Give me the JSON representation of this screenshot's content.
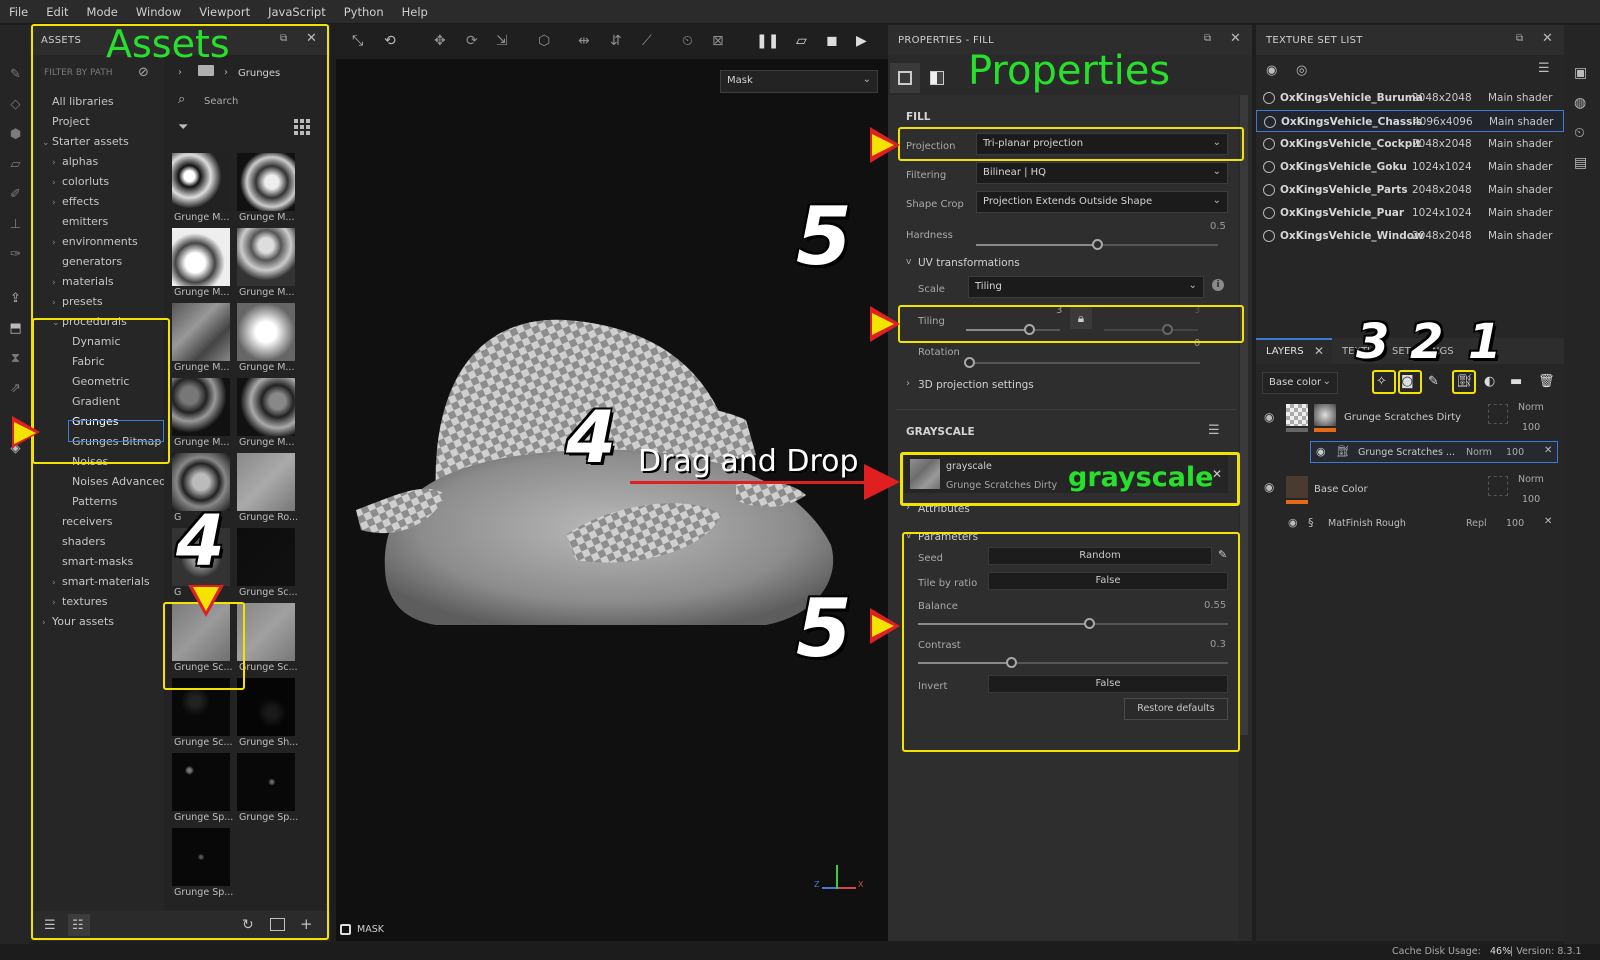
{
  "menu": [
    "File",
    "Edit",
    "Mode",
    "Window",
    "Viewport",
    "JavaScript",
    "Python",
    "Help"
  ],
  "assets": {
    "title": "ASSETS",
    "annotation": "Assets",
    "filter_label": "FILTER BY PATH",
    "breadcrumb": "Grunges",
    "search_placeholder": "Search",
    "tree": [
      {
        "label": "All libraries",
        "indent": 0,
        "chev": ""
      },
      {
        "label": "Project",
        "indent": 0,
        "chev": ""
      },
      {
        "label": "Starter assets",
        "indent": 0,
        "chev": "v"
      },
      {
        "label": "alphas",
        "indent": 1,
        "chev": ">"
      },
      {
        "label": "colorluts",
        "indent": 1,
        "chev": ">"
      },
      {
        "label": "effects",
        "indent": 1,
        "chev": ">"
      },
      {
        "label": "emitters",
        "indent": 1,
        "chev": ""
      },
      {
        "label": "environments",
        "indent": 1,
        "chev": ">"
      },
      {
        "label": "generators",
        "indent": 1,
        "chev": ""
      },
      {
        "label": "materials",
        "indent": 1,
        "chev": ">"
      },
      {
        "label": "presets",
        "indent": 1,
        "chev": ">"
      },
      {
        "label": "procedurals",
        "indent": 1,
        "chev": "v"
      },
      {
        "label": "Dynamic",
        "indent": 2,
        "chev": ""
      },
      {
        "label": "Fabric",
        "indent": 2,
        "chev": ""
      },
      {
        "label": "Geometric",
        "indent": 2,
        "chev": ""
      },
      {
        "label": "Gradient",
        "indent": 2,
        "chev": ""
      },
      {
        "label": "Grunges",
        "indent": 2,
        "chev": ""
      },
      {
        "label": "Grunges Bitmap",
        "indent": 2,
        "chev": ""
      },
      {
        "label": "Noises",
        "indent": 2,
        "chev": ""
      },
      {
        "label": "Noises Advanced",
        "indent": 2,
        "chev": ""
      },
      {
        "label": "Patterns",
        "indent": 2,
        "chev": ""
      },
      {
        "label": "receivers",
        "indent": 1,
        "chev": ""
      },
      {
        "label": "shaders",
        "indent": 1,
        "chev": ""
      },
      {
        "label": "smart-masks",
        "indent": 1,
        "chev": ""
      },
      {
        "label": "smart-materials",
        "indent": 1,
        "chev": ">"
      },
      {
        "label": "textures",
        "indent": 1,
        "chev": ">"
      },
      {
        "label": "Your assets",
        "indent": 0,
        "chev": ">"
      }
    ],
    "thumbs": [
      "Grunge M...",
      "Grunge M...",
      "Grunge M...",
      "Grunge M...",
      "Grunge M...",
      "Grunge M...",
      "Grunge M...",
      "Grunge M...",
      "G",
      "Grunge Ro...",
      "G",
      "Grunge Sc...",
      "Grunge Sc...",
      "Grunge Sc...",
      "Grunge Sc...",
      "Grunge Sh...",
      "Grunge Sp...",
      "Grunge Sp...",
      "Grunge Sp..."
    ]
  },
  "viewport": {
    "mode_dropdown": "Mask",
    "footer_label": "MASK",
    "axes": {
      "x": "X",
      "z": "Z"
    },
    "annotation_drag": "Drag and Drop"
  },
  "properties": {
    "title": "PROPERTIES - FILL",
    "annotation": "Properties",
    "fill_header": "FILL",
    "projection_label": "Projection",
    "projection_value": "Tri-planar projection",
    "filtering_label": "Filtering",
    "filtering_value": "Bilinear | HQ",
    "shapecrop_label": "Shape Crop",
    "shapecrop_value": "Projection Extends Outside Shape",
    "hardness_label": "Hardness",
    "hardness_value": "0.5",
    "uv_header": "UV transformations",
    "scale_label": "Scale",
    "scale_value": "Tiling",
    "tiling_label": "Tiling",
    "tiling_value": "3",
    "tiling_value2": "3",
    "rotation_label": "Rotation",
    "rotation_value": "0",
    "proj3d_header": "3D projection settings",
    "grayscale_header": "GRAYSCALE",
    "grayscale_name": "grayscale",
    "grayscale_resource": "Grunge Scratches Dirty",
    "grayscale_annotation": "grayscale",
    "attributes_header": "Attributes",
    "parameters_header": "Parameters",
    "seed_label": "Seed",
    "seed_value": "Random",
    "tile_ratio_label": "Tile by ratio",
    "tile_ratio_value": "False",
    "balance_label": "Balance",
    "balance_value": "0.55",
    "contrast_label": "Contrast",
    "contrast_value": "0.3",
    "invert_label": "Invert",
    "invert_value": "False",
    "restore_label": "Restore defaults"
  },
  "texture_sets": {
    "title": "TEXTURE SET LIST",
    "rows": [
      {
        "name": "OxKingsVehicle_Buruma",
        "res": "2048x2048",
        "shader": "Main shader"
      },
      {
        "name": "OxKingsVehicle_Chassis",
        "res": "4096x4096",
        "shader": "Main shader"
      },
      {
        "name": "OxKingsVehicle_Cockpit",
        "res": "2048x2048",
        "shader": "Main shader"
      },
      {
        "name": "OxKingsVehicle_Goku",
        "res": "1024x1024",
        "shader": "Main shader"
      },
      {
        "name": "OxKingsVehicle_Parts",
        "res": "2048x2048",
        "shader": "Main shader"
      },
      {
        "name": "OxKingsVehicle_Puar",
        "res": "1024x1024",
        "shader": "Main shader"
      },
      {
        "name": "OxKingsVehicle_Window",
        "res": "2048x2048",
        "shader": "Main shader"
      }
    ]
  },
  "layers": {
    "tab_layers": "LAYERS",
    "tab_texture": "TEXTU",
    "tab_set": "SET",
    "tab_ngs": "NGS",
    "channel_dropdown": "Base color",
    "items": [
      {
        "name": "Grunge Scratches Dirty",
        "blend": "Norm",
        "opacity": "100"
      },
      {
        "name": "Grunge Scratches ...",
        "blend": "Norm",
        "opacity": "100"
      },
      {
        "name": "Base Color",
        "blend": "Norm",
        "opacity": "100"
      },
      {
        "name": "MatFinish Rough",
        "blend": "Repl",
        "opacity": "100"
      }
    ]
  },
  "annotations": {
    "n1": "1",
    "n2": "2",
    "n3": "3",
    "n4a": "4",
    "n4b": "4",
    "n5a": "5",
    "n5b": "5"
  },
  "status": {
    "cache": "Cache Disk Usage:",
    "cache_value": "46%",
    "version": "| Version: 8.3.1"
  },
  "colors": {
    "annotation_yellow": "#f2e400",
    "annotation_green": "#27e02b",
    "annotation_red": "#e02020",
    "selection_blue": "#3a7bd5"
  }
}
